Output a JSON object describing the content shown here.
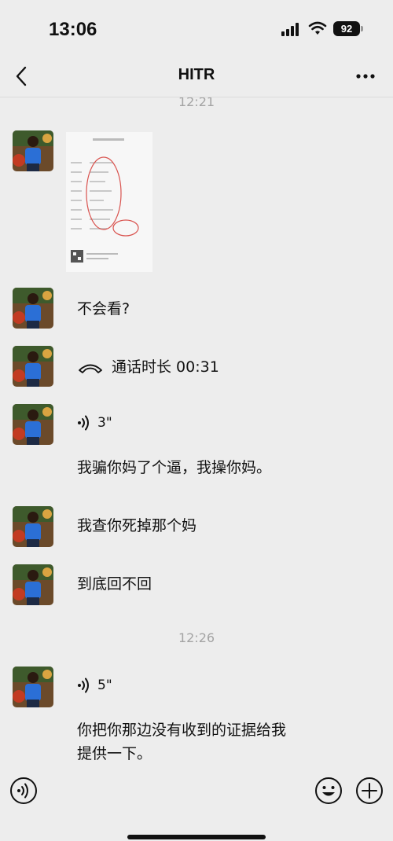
{
  "status_bar": {
    "time": "13:06",
    "battery": "92"
  },
  "nav": {
    "title": "HITR"
  },
  "timestamps": [
    "12:21",
    "12:26"
  ],
  "messages": {
    "m1_text": "不会看?",
    "call_label": "通话时长 00:31",
    "voice1_duration": "3\"",
    "voice1_transcript": "我骗你妈了个逼，我操你妈。",
    "m2_text": "我查你死掉那个妈",
    "m3_text": "到底回不回",
    "voice2_duration": "5\"",
    "voice2_transcript_line1": "你把你那边没有收到的证据给我",
    "voice2_transcript_line2": "提供一下。"
  },
  "colors": {
    "background": "#ededed",
    "timestamp": "#a3a3a3",
    "text": "#111111"
  }
}
